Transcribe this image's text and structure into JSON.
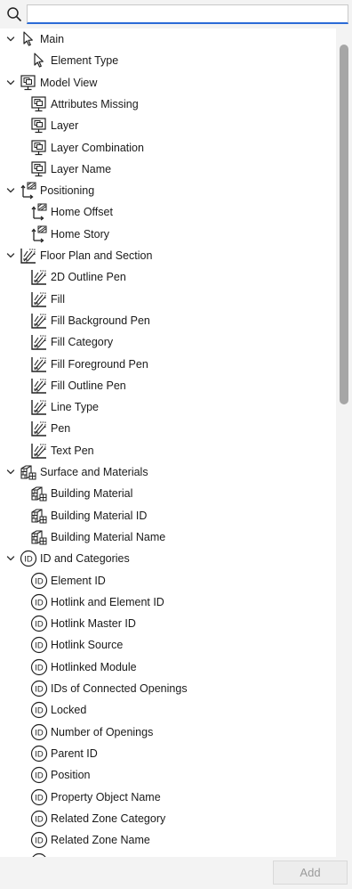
{
  "search": {
    "value": "",
    "placeholder": "",
    "icon": "search-icon"
  },
  "tree": [
    {
      "label": "Main",
      "icon": "cursor-icon",
      "expanded": true,
      "children": [
        "Element Type"
      ]
    },
    {
      "label": "Model View",
      "icon": "model-view-icon",
      "expanded": true,
      "children": [
        "Attributes Missing",
        "Layer",
        "Layer Combination",
        "Layer Name"
      ]
    },
    {
      "label": "Positioning",
      "icon": "positioning-icon",
      "expanded": true,
      "children": [
        "Home Offset",
        "Home Story"
      ]
    },
    {
      "label": "Floor Plan and Section",
      "icon": "floor-plan-icon",
      "expanded": true,
      "children": [
        "2D Outline Pen",
        "Fill",
        "Fill Background Pen",
        "Fill Category",
        "Fill Foreground Pen",
        "Fill Outline Pen",
        "Line Type",
        "Pen",
        "Text Pen"
      ]
    },
    {
      "label": "Surface and Materials",
      "icon": "materials-icon",
      "expanded": true,
      "children": [
        "Building Material",
        "Building Material ID",
        "Building Material Name"
      ]
    },
    {
      "label": "ID and Categories",
      "icon": "id-icon",
      "expanded": true,
      "children": [
        "Element ID",
        "Hotlink and Element ID",
        "Hotlink Master ID",
        "Hotlink Source",
        "Hotlinked Module",
        "IDs of Connected Openings",
        "Locked",
        "Number of Openings",
        "Parent ID",
        "Position",
        "Property Object Name",
        "Related Zone Category",
        "Related Zone Name",
        ""
      ]
    }
  ],
  "footer": {
    "add_label": "Add"
  }
}
